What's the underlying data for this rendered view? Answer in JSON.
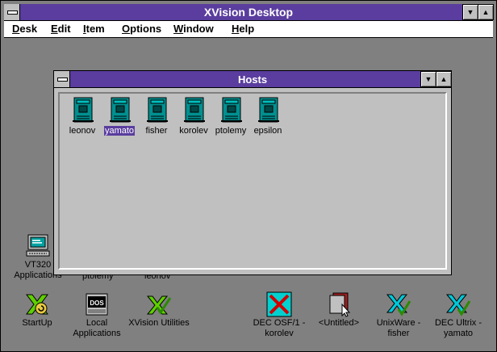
{
  "window": {
    "title": "XVision Desktop",
    "title_bar_color": "#5a3d9e"
  },
  "menu": {
    "items": [
      {
        "label": "Desk",
        "accel": "D"
      },
      {
        "label": "Edit",
        "accel": "E"
      },
      {
        "label": "Item",
        "accel": "I"
      },
      {
        "label": "Options",
        "accel": "O"
      },
      {
        "label": "Window",
        "accel": "W"
      },
      {
        "label": "Help",
        "accel": "H"
      }
    ]
  },
  "hosts_window": {
    "title": "Hosts",
    "hosts": [
      {
        "label": "leonov",
        "icon": "server-icon"
      },
      {
        "label": "yamato",
        "icon": "server-icon",
        "selected": true
      },
      {
        "label": "fisher",
        "icon": "server-icon"
      },
      {
        "label": "korolev",
        "icon": "server-icon"
      },
      {
        "label": "ptolemy",
        "icon": "server-icon"
      },
      {
        "label": "epsilon",
        "icon": "server-icon"
      }
    ]
  },
  "desktop": {
    "partial_labels": [
      "ptolemy",
      "leonov"
    ],
    "icons": [
      {
        "label": "VT320",
        "label2": "Applications",
        "icon": "terminal-icon"
      },
      {
        "label": "StartUp",
        "label2": "",
        "icon": "startup-icon"
      },
      {
        "label": "Local",
        "label2": "Applications",
        "icon": "dos-icon"
      },
      {
        "label": "XVision Utilities",
        "label2": "",
        "icon": "xvision-utilities-icon"
      },
      {
        "label": "DEC OSF/1 -",
        "label2": "korolev",
        "icon": "x-session-icon"
      },
      {
        "label": "<Untitled>",
        "label2": "",
        "icon": "untitled-icon"
      },
      {
        "label": "UnixWare -",
        "label2": "fisher",
        "icon": "xvision-session-icon"
      },
      {
        "label": "DEC Ultrix -",
        "label2": "yamato",
        "icon": "xvision-session-icon"
      }
    ]
  }
}
